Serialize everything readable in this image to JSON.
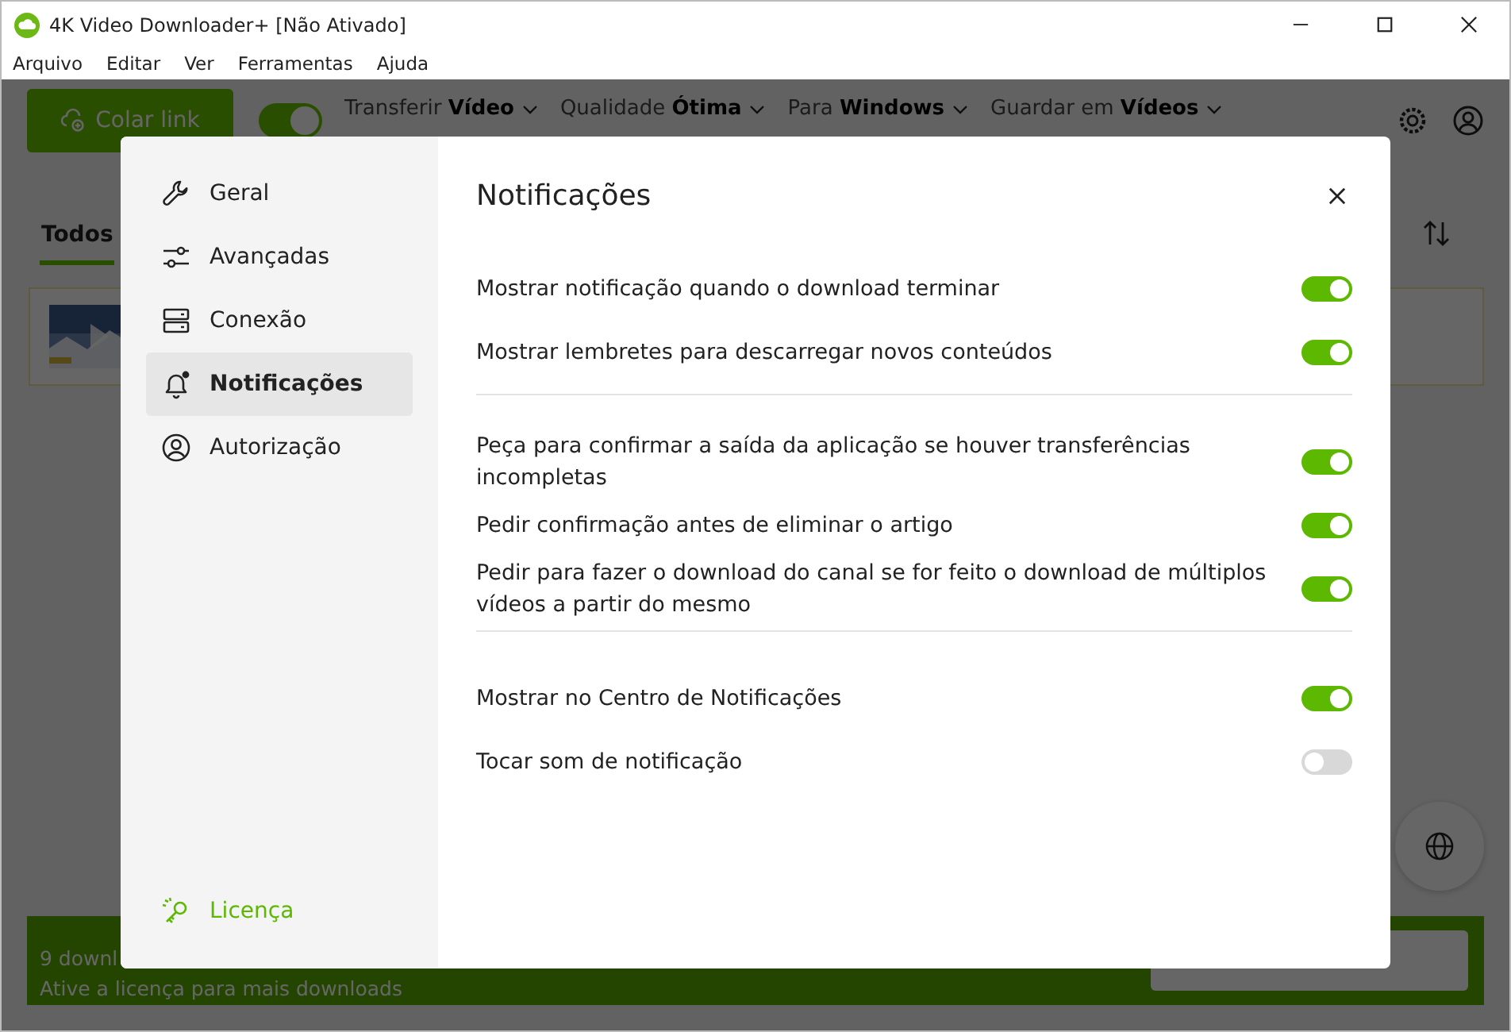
{
  "window": {
    "title": "4K Video Downloader+ [Não Ativado]"
  },
  "menu": [
    "Arquivo",
    "Editar",
    "Ver",
    "Ferramentas",
    "Ajuda"
  ],
  "toolbar": {
    "paste_button": "Colar link",
    "smart_mode": {
      "on": true
    },
    "dropdowns": [
      {
        "label": "Transferir",
        "value": "Vídeo"
      },
      {
        "label": "Qualidade",
        "value": "Ótima"
      },
      {
        "label": "Para",
        "value": "Windows"
      },
      {
        "label": "Guardar em",
        "value": "Vídeos"
      }
    ]
  },
  "tabs": [
    {
      "label": "Todos",
      "selected": true
    }
  ],
  "banner": {
    "title": "9 downl",
    "subtitle": "Ative a licença para mais downloads"
  },
  "dialog": {
    "nav": [
      {
        "label": "Geral",
        "selected": false
      },
      {
        "label": "Avançadas",
        "selected": false
      },
      {
        "label": "Conexão",
        "selected": false
      },
      {
        "label": "Notificações",
        "selected": true
      },
      {
        "label": "Autorização",
        "selected": false
      }
    ],
    "license": "Licença",
    "title": "Notificações",
    "sections": [
      {
        "options": [
          {
            "label": "Mostrar notificação quando o download terminar",
            "on": true
          },
          {
            "label": "Mostrar lembretes para descarregar novos conteúdos",
            "on": true
          }
        ]
      },
      {
        "options": [
          {
            "label": "Peça para confirmar a saída da aplicação se houver transferências incompletas",
            "on": true
          },
          {
            "label": "Pedir confirmação antes de eliminar o artigo",
            "on": true
          },
          {
            "label": "Pedir para fazer o download do canal se for feito o download de múltiplos vídeos a partir do mesmo",
            "on": true
          }
        ]
      },
      {
        "options": [
          {
            "label": "Mostrar no Centro de Notificações",
            "on": true
          },
          {
            "label": "Tocar som de notificação",
            "on": false
          }
        ]
      }
    ]
  }
}
